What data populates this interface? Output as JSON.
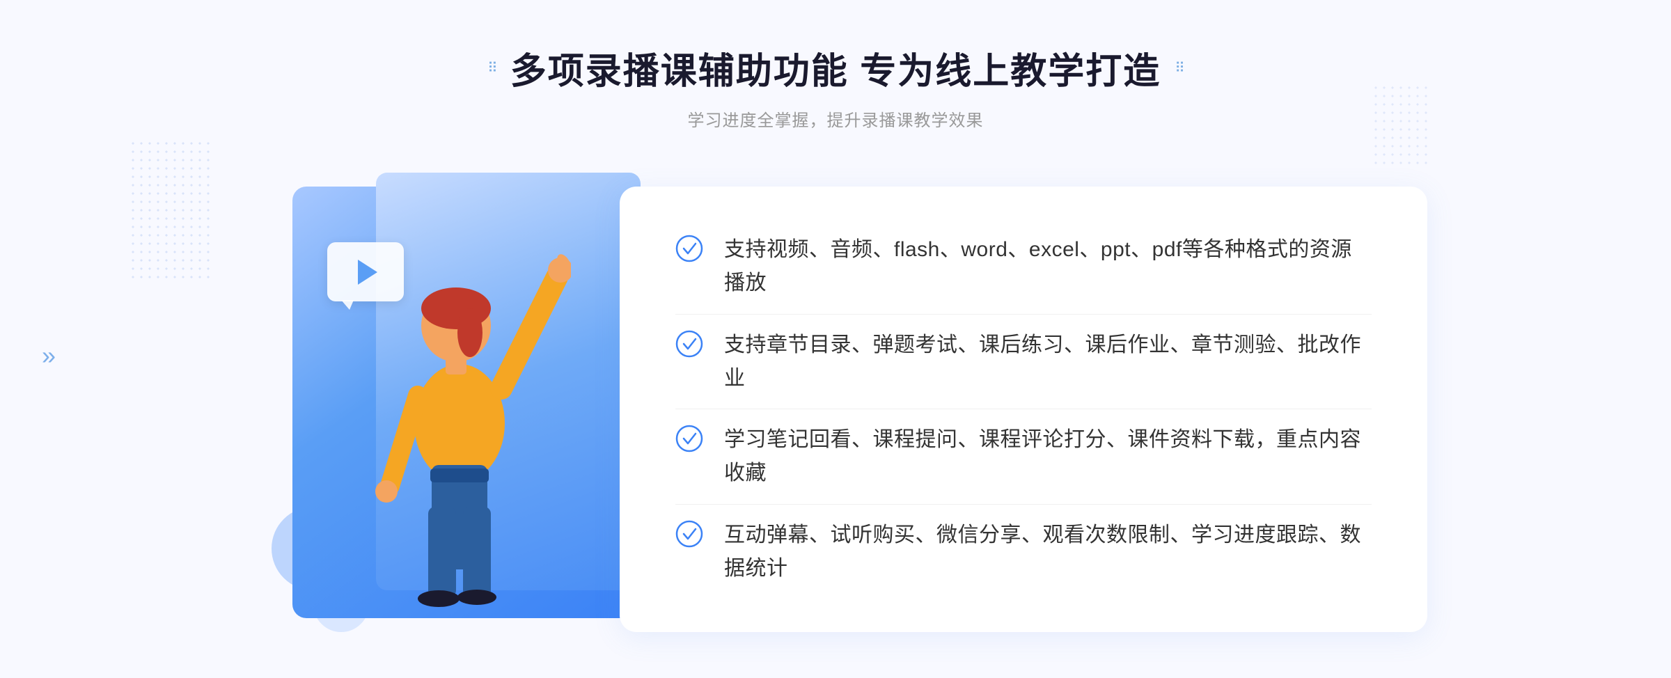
{
  "page": {
    "background": "#f8f9ff"
  },
  "header": {
    "title": "多项录播课辅助功能 专为线上教学打造",
    "subtitle": "学习进度全掌握，提升录播课教学效果",
    "dots_left": "⠿",
    "dots_right": "⠿"
  },
  "features": [
    {
      "id": 1,
      "text": "支持视频、音频、flash、word、excel、ppt、pdf等各种格式的资源播放"
    },
    {
      "id": 2,
      "text": "支持章节目录、弹题考试、课后练习、课后作业、章节测验、批改作业"
    },
    {
      "id": 3,
      "text": "学习笔记回看、课程提问、课程评论打分、课件资料下载，重点内容收藏"
    },
    {
      "id": 4,
      "text": "互动弹幕、试听购买、微信分享、观看次数限制、学习进度跟踪、数据统计"
    }
  ],
  "colors": {
    "primary_blue": "#3b82f6",
    "light_blue": "#a8c8ff",
    "check_circle": "#3b82f6",
    "text_dark": "#333333",
    "text_light": "#999999",
    "title_color": "#1a1a2e"
  },
  "arrow_left": "»"
}
